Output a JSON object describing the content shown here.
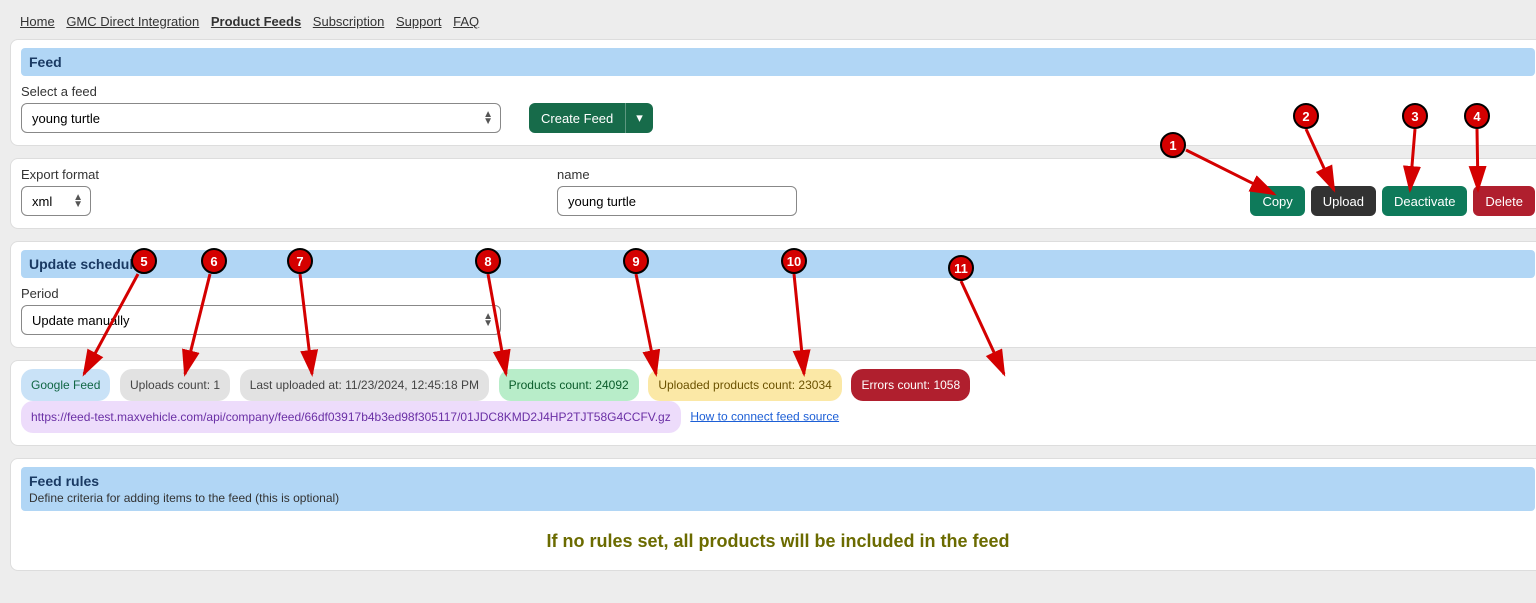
{
  "nav": {
    "home": "Home",
    "gmc": "GMC Direct Integration",
    "feeds": "Product Feeds",
    "subscription": "Subscription",
    "support": "Support",
    "faq": "FAQ"
  },
  "feed_panel": {
    "header": "Feed",
    "select_label": "Select a feed",
    "selected": "young turtle",
    "create_btn": "Create Feed"
  },
  "export_panel": {
    "format_label": "Export format",
    "format_value": "xml",
    "name_label": "name",
    "name_value": "young turtle",
    "btn_copy": "Copy",
    "btn_upload": "Upload",
    "btn_deactivate": "Deactivate",
    "btn_delete": "Delete"
  },
  "schedule_panel": {
    "header": "Update schedule",
    "period_label": "Period",
    "period_value": "Update manually"
  },
  "badges": {
    "feed_type": "Google Feed",
    "uploads_count": "Uploads count: 1",
    "last_uploaded": "Last uploaded at: 11/23/2024, 12:45:18 PM",
    "products_count": "Products count: 24092",
    "uploaded_products": "Uploaded products count: 23034",
    "errors_count": "Errors count: 1058",
    "url": "https://feed-test.maxvehicle.com/api/company/feed/66df03917b4b3ed98f305117/01JDC8KMD2J4HP2TJT58G4CCFV.gz",
    "howto": "How to connect feed source"
  },
  "rules_panel": {
    "header": "Feed rules",
    "sub": "Define criteria for adding items to the feed (this is optional)",
    "norules": "If no rules set, all products will be included in the feed"
  },
  "markers": [
    "1",
    "2",
    "3",
    "4",
    "5",
    "6",
    "7",
    "8",
    "9",
    "10",
    "11"
  ]
}
